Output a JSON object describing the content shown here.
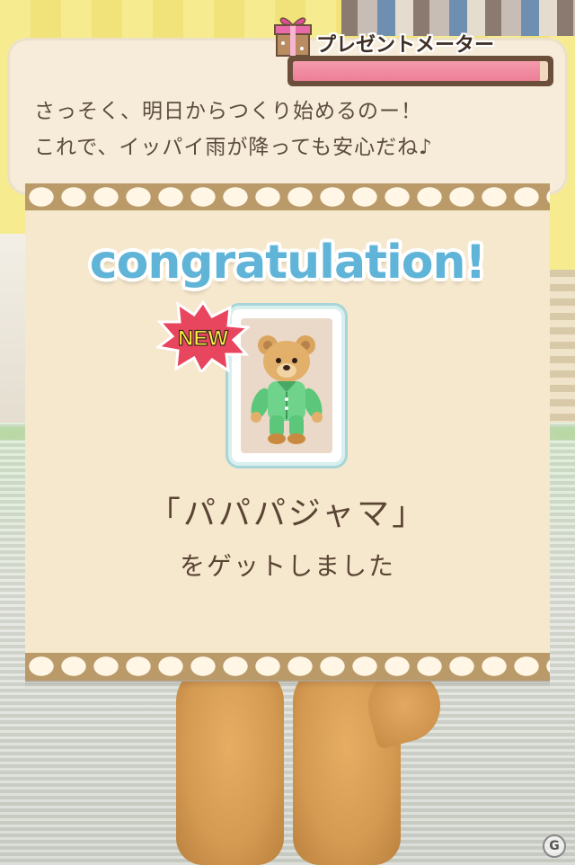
{
  "present_meter": {
    "title": "プレゼントメーター",
    "level": 0.97,
    "fill_color": "#ee8aa0",
    "icon": "gift-box-icon"
  },
  "speech": {
    "line1": "さっそく、明日からつくり始めるのー！",
    "line2": "これで、イッパイ雨が降っても安心だね♪"
  },
  "reward": {
    "heading": "congratulation!",
    "badge": "NEW",
    "item_name": "「パパパジャマ」",
    "caption": "をゲットしました",
    "item_icon": "teddy-bear-pajama-icon"
  },
  "colors": {
    "heading": "#5fb4d8",
    "text": "#5a4434",
    "card": "#f6e8cd",
    "border": "#b99a68"
  }
}
